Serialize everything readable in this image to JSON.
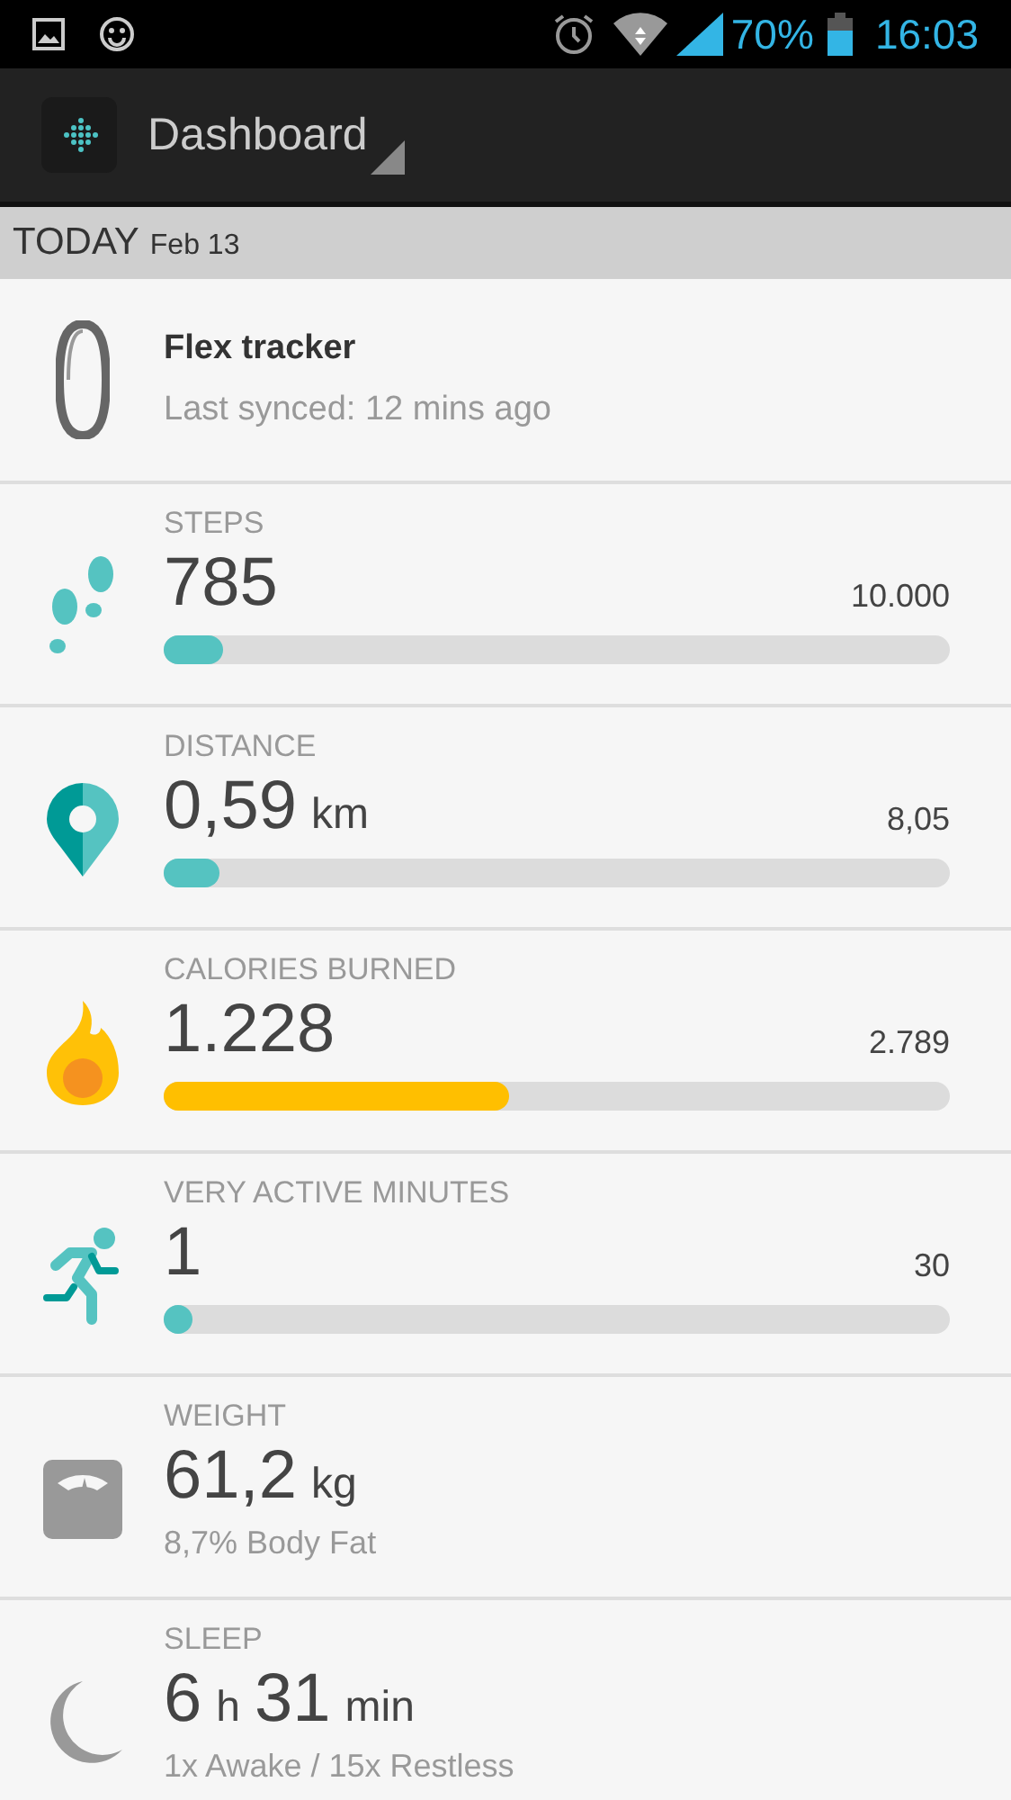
{
  "status_bar": {
    "battery": "70%",
    "time": "16:03"
  },
  "action_bar": {
    "title": "Dashboard"
  },
  "date_header": {
    "day": "TODAY",
    "date": "Feb 13"
  },
  "device": {
    "name": "Flex tracker",
    "synced": "Last synced: 12 mins ago"
  },
  "tiles": [
    {
      "kind": "steps",
      "label": "STEPS",
      "value": [
        {
          "text": "785",
          "kind": "number"
        }
      ],
      "goal": "10.000",
      "level": 0.075,
      "color": "#55c3c1"
    },
    {
      "kind": "distance",
      "label": "DISTANCE",
      "value": [
        {
          "text": "0,59",
          "kind": "number"
        },
        {
          "text": "km",
          "kind": "unit"
        }
      ],
      "goal": "8,05",
      "level": 0.07,
      "color": "#55c3c1"
    },
    {
      "kind": "calories",
      "label": "CALORIES BURNED",
      "value": [
        {
          "text": "1.228",
          "kind": "number"
        }
      ],
      "goal": "2.789",
      "level": 0.44,
      "color": "#ffbf00"
    },
    {
      "kind": "active",
      "label": "VERY ACTIVE MINUTES",
      "value": [
        {
          "text": "1",
          "kind": "number"
        }
      ],
      "goal": "30",
      "level": 0.03,
      "color": "#55c3c1"
    },
    {
      "kind": "weight",
      "label": "WEIGHT",
      "value": [
        {
          "text": "61,2",
          "kind": "number"
        },
        {
          "text": "kg",
          "kind": "unit"
        }
      ],
      "detail": "8,7% Body Fat"
    },
    {
      "kind": "sleep",
      "label": "SLEEP",
      "value": [
        {
          "text": "6",
          "kind": "number"
        },
        {
          "text": "h",
          "kind": "unit"
        },
        {
          "text": "31",
          "kind": "number"
        },
        {
          "text": "min",
          "kind": "unit"
        }
      ],
      "detail": "1x Awake / 15x Restless"
    }
  ]
}
